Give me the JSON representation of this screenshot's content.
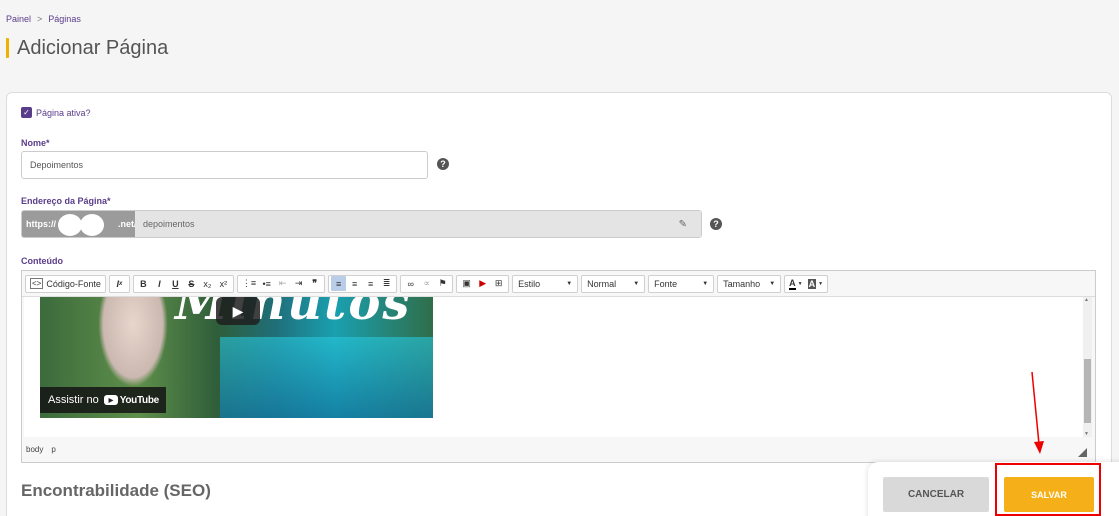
{
  "breadcrumb": {
    "root": "Painel",
    "separator": ">",
    "current": "Páginas"
  },
  "page": {
    "title": "Adicionar Página"
  },
  "form": {
    "active_label": "Página ativa?",
    "active_checked": true,
    "name_label": "Nome*",
    "name_value": "Depoimentos",
    "url_label": "Endereço da Página*",
    "url_prefix_start": "https://",
    "url_prefix_end": ".net/p",
    "url_slug": "depoimentos",
    "content_label": "Conteúdo"
  },
  "toolbar": {
    "source_label": "Código-Fonte",
    "style_label": "Estilo",
    "format_label": "Normal",
    "font_label": "Fonte",
    "size_label": "Tamanho",
    "subscript": "x₂",
    "superscript": "x²"
  },
  "video": {
    "watch_label": "Assistir no",
    "brand": "YouTube",
    "overlay_text": "Minutos"
  },
  "pathbar": [
    "body",
    "p"
  ],
  "seo": {
    "title": "Encontrabilidade (SEO)"
  },
  "actions": {
    "cancel_label": "CANCELAR",
    "save_label": "SALVAR"
  },
  "colors": {
    "accent": "#5a3d8a",
    "save": "#f5b019",
    "title_bar": "#f1b000",
    "highlight": "#e00000"
  }
}
